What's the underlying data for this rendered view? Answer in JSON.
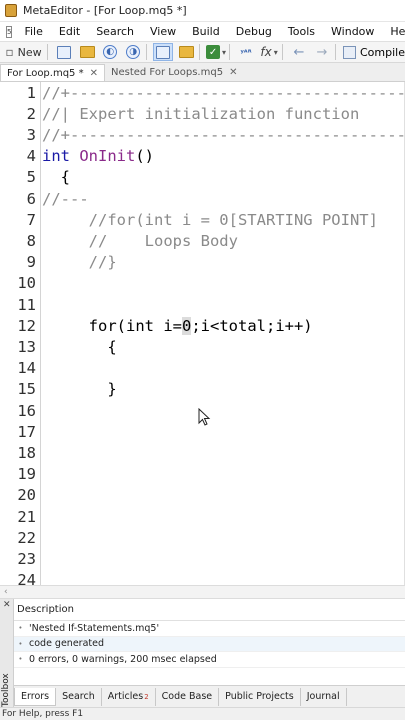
{
  "window": {
    "title": "MetaEditor - [For Loop.mq5 *]"
  },
  "menu": {
    "doc_icon": "5",
    "items": [
      "File",
      "Edit",
      "Search",
      "View",
      "Build",
      "Debug",
      "Tools",
      "Window",
      "Help"
    ]
  },
  "toolbar": {
    "new_label": "New",
    "compile_label": "Compile",
    "icons": [
      "new-file-icon",
      "open-folder-icon",
      "back-history-icon",
      "forward-history-icon",
      "navigator-icon",
      "folder-icon",
      "check-icon",
      "var-icon",
      "fx-icon",
      "back-arrow-icon",
      "forward-arrow-icon",
      "compile-icon"
    ]
  },
  "tabs": [
    {
      "label": "For Loop.mq5 *",
      "close": "✕"
    },
    {
      "label": "Nested For Loops.mq5",
      "close": "✕"
    }
  ],
  "editor": {
    "lines": [
      {
        "n": "1",
        "fold": "",
        "text": "//+--------------------------------------------"
      },
      {
        "n": "2",
        "fold": "",
        "text": "//| Expert initialization function"
      },
      {
        "n": "3",
        "fold": "",
        "text": "//+--------------------------------------------"
      },
      {
        "n": "4",
        "fold": "",
        "text": "int OnInit()"
      },
      {
        "n": "5",
        "fold": "",
        "text": "  {"
      },
      {
        "n": "6",
        "fold": "",
        "text": "//---"
      },
      {
        "n": "7",
        "fold": "",
        "text": "     //for(int i = 0[STARTING POINT]"
      },
      {
        "n": "8",
        "fold": "",
        "text": "     //    Loops Body"
      },
      {
        "n": "9",
        "fold": "",
        "text": "     //}"
      },
      {
        "n": "10",
        "fold": "",
        "text": ""
      },
      {
        "n": "11",
        "fold": "",
        "text": ""
      },
      {
        "n": "12",
        "fold": "",
        "text": "     for(int i=0;i<total;i++)"
      },
      {
        "n": "13",
        "fold": "",
        "text": "       {"
      },
      {
        "n": "14",
        "fold": "",
        "text": ""
      },
      {
        "n": "15",
        "fold": "",
        "text": "       }"
      },
      {
        "n": "16",
        "fold": "",
        "text": ""
      },
      {
        "n": "17",
        "fold": "",
        "text": ""
      },
      {
        "n": "18",
        "fold": "",
        "text": ""
      },
      {
        "n": "19",
        "fold": "",
        "text": ""
      },
      {
        "n": "20",
        "fold": "",
        "text": ""
      },
      {
        "n": "21",
        "fold": "",
        "text": ""
      },
      {
        "n": "22",
        "fold": "",
        "text": ""
      },
      {
        "n": "23",
        "fold": "",
        "text": ""
      },
      {
        "n": "24",
        "fold": "",
        "text": ""
      }
    ],
    "parts": {
      "l2_prefix": "//|",
      "l2_rest": " Expert initialization function",
      "l4_kw": "int",
      "l4_fn": "OnInit",
      "l4_rest": "()",
      "l12_pre": "     for(int i=",
      "l12_sel": "0",
      "l12_post": ";i<total;i++)"
    }
  },
  "toolbox": {
    "header": "Description",
    "rows": [
      "'Nested If-Statements.mq5'",
      "code generated",
      "0 errors, 0 warnings, 200 msec elapsed"
    ],
    "strip_label": "Toolbox",
    "close_glyph": "✕"
  },
  "bottom_tabs": [
    {
      "label": "Errors",
      "badge": ""
    },
    {
      "label": "Search",
      "badge": ""
    },
    {
      "label": "Articles",
      "badge": "2"
    },
    {
      "label": "Code Base",
      "badge": ""
    },
    {
      "label": "Public Projects",
      "badge": ""
    },
    {
      "label": "Journal",
      "badge": ""
    }
  ],
  "status": {
    "text": "For Help, press F1"
  },
  "colors": {
    "comment": "#8a8a8a",
    "keyword": "#1a1aa6",
    "function": "#8a2a8a",
    "selection": "#dcdcdc"
  }
}
